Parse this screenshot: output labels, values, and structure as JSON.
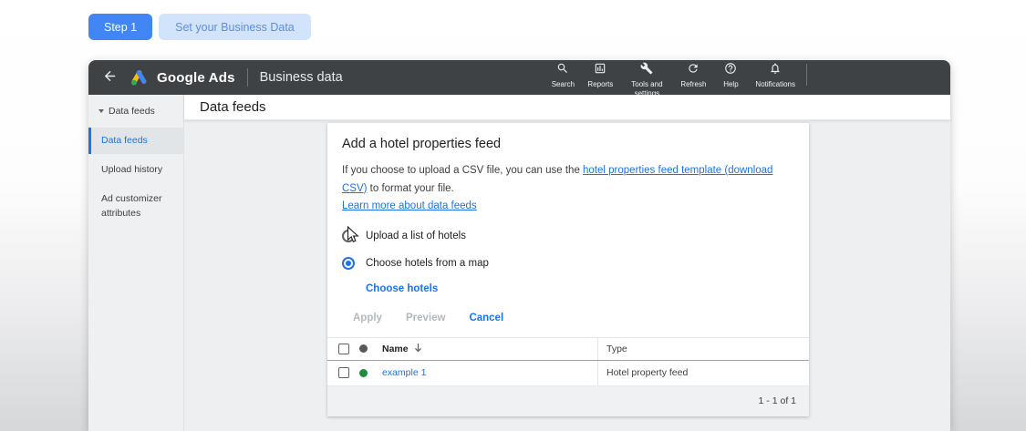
{
  "stepper": {
    "step_label": "Step 1",
    "step_title": "Set your Business Data"
  },
  "header": {
    "brand": "Google Ads",
    "section_title": "Business data",
    "nav_items": [
      {
        "icon": "search-icon",
        "label": "Search"
      },
      {
        "icon": "reports-icon",
        "label": "Reports"
      },
      {
        "icon": "tools-icon",
        "label": "Tools and settings"
      },
      {
        "icon": "refresh-icon",
        "label": "Refresh"
      },
      {
        "icon": "help-icon",
        "label": "Help"
      },
      {
        "icon": "notifications-icon",
        "label": "Notifications"
      }
    ]
  },
  "sidebar": {
    "parent": {
      "label": "Data feeds",
      "expanded": true
    },
    "items": [
      {
        "label": "Data feeds",
        "selected": true
      },
      {
        "label": "Upload history",
        "selected": false
      },
      {
        "label": "Ad customizer attributes",
        "selected": false
      }
    ]
  },
  "page": {
    "title": "Data feeds"
  },
  "dialog": {
    "title": "Add a hotel properties feed",
    "description_prefix": "If you choose to upload a CSV file, you can use the ",
    "template_link": "hotel properties feed template (download CSV)",
    "description_suffix": " to format your file.",
    "learn_more_link": "Learn more about data feeds",
    "radios": [
      {
        "label": "Upload a list of hotels",
        "selected": false
      },
      {
        "label": "Choose hotels from a map",
        "selected": true
      }
    ],
    "choose_hotels_link": "Choose hotels",
    "buttons": {
      "apply": "Apply",
      "preview": "Preview",
      "cancel": "Cancel"
    }
  },
  "table": {
    "columns": {
      "name": "Name",
      "type": "Type"
    },
    "rows": [
      {
        "name": "example 1",
        "type": "Hotel property feed",
        "status_color": "#1e8e3e"
      }
    ],
    "pagination": "1 - 1 of 1"
  },
  "colors": {
    "accent_blue": "#1a73e8",
    "appbar_bg": "#3f4245",
    "step_button_bg": "#4285f4",
    "step_pill_bg": "#d2e3fc",
    "status_green": "#1e8e3e",
    "status_gray": "#55595e",
    "content_bg": "#edeff1"
  }
}
